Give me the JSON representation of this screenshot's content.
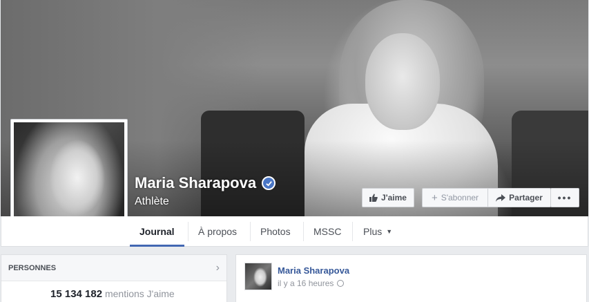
{
  "page": {
    "name": "Maria Sharapova",
    "category": "Athlète"
  },
  "actions": {
    "like": "J'aime",
    "follow": "S'abonner",
    "share": "Partager",
    "more": "•••"
  },
  "tabs": [
    {
      "label": "Journal",
      "active": true
    },
    {
      "label": "À propos",
      "active": false
    },
    {
      "label": "Photos",
      "active": false
    },
    {
      "label": "MSSC",
      "active": false
    },
    {
      "label": "Plus",
      "active": false
    }
  ],
  "people": {
    "title": "PERSONNES",
    "likes_count": "15 134 182",
    "likes_label": "mentions J'aime"
  },
  "post": {
    "author": "Maria Sharapova",
    "time": "il y a 16 heures"
  },
  "icons": {
    "verified": "verified-badge-icon",
    "like": "thumbs-up-icon",
    "follow": "plus-icon",
    "share": "share-arrow-icon",
    "people_chevron": "chevron-right-icon",
    "privacy": "globe-icon"
  },
  "colors": {
    "link_blue": "#365899",
    "tab_underline": "#4267b2",
    "verified_blue": "#4a76c5"
  }
}
